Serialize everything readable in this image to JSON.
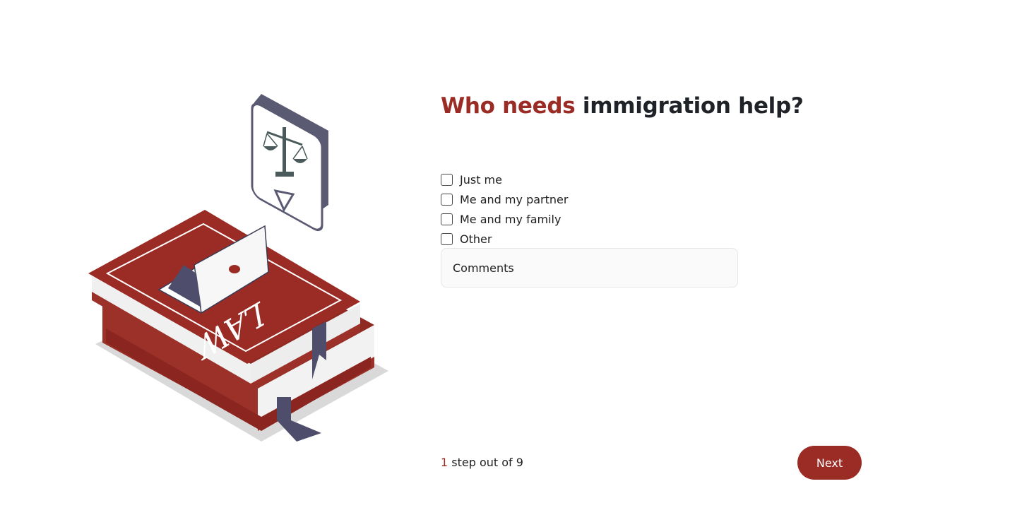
{
  "question": {
    "title_accent": "Who needs",
    "title_rest": " immigration help?"
  },
  "options": [
    {
      "label": "Just me",
      "checked": false
    },
    {
      "label": "Me and my partner",
      "checked": false
    },
    {
      "label": "Me and my family",
      "checked": false
    },
    {
      "label": "Other",
      "checked": false
    }
  ],
  "comments": {
    "placeholder": "Comments"
  },
  "footer": {
    "step_current": "1",
    "step_text": " step out of 9",
    "next_label": "Next"
  },
  "illustration": {
    "book_text": "LAW",
    "icon": "scales-of-justice-icon"
  },
  "colors": {
    "accent": "#9b2c25",
    "ribbon": "#4e4d6b"
  }
}
